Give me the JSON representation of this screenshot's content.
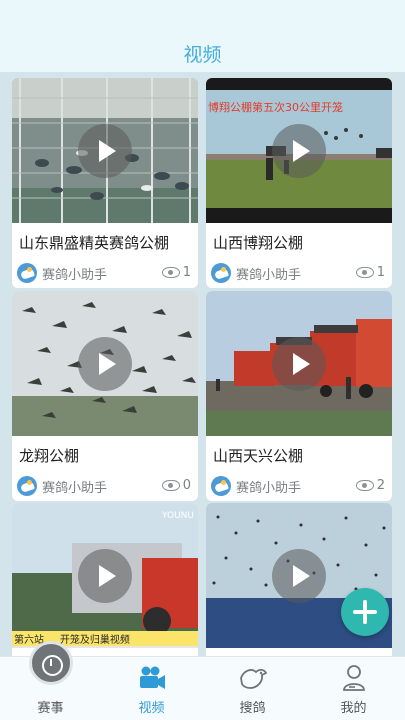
{
  "header": {
    "title": "视频"
  },
  "videos": [
    {
      "title": "山东鼎盛精英赛鸽公棚",
      "author": "赛鸽小助手",
      "views": "1"
    },
    {
      "title": "山西博翔公棚",
      "author": "赛鸽小助手",
      "views": "1",
      "overlay_text": "博翔公棚第五次30公里开笼"
    },
    {
      "title": "龙翔公棚",
      "author": "赛鸽小助手",
      "views": "0"
    },
    {
      "title": "山西天兴公棚",
      "author": "赛鸽小助手",
      "views": "2"
    },
    {
      "title": "",
      "author": "",
      "views": "",
      "watermark": "YOUNU",
      "overlay_text": "第六站 ... 开笼及归巢视频"
    },
    {
      "title": "",
      "author": "",
      "views": ""
    }
  ],
  "fab": {
    "icon": "plus-icon"
  },
  "tabbar": {
    "tabs": [
      {
        "label": "赛事",
        "icon": "stopwatch-icon",
        "active": false
      },
      {
        "label": "视频",
        "icon": "video-camera-icon",
        "active": true
      },
      {
        "label": "搜鸽",
        "icon": "pigeon-icon",
        "active": false
      },
      {
        "label": "我的",
        "icon": "person-icon",
        "active": false
      }
    ]
  },
  "colors": {
    "accent": "#2f9bd6",
    "title": "#44aedd",
    "fab": "#2fb8b0",
    "background": "#d4e4eb"
  }
}
